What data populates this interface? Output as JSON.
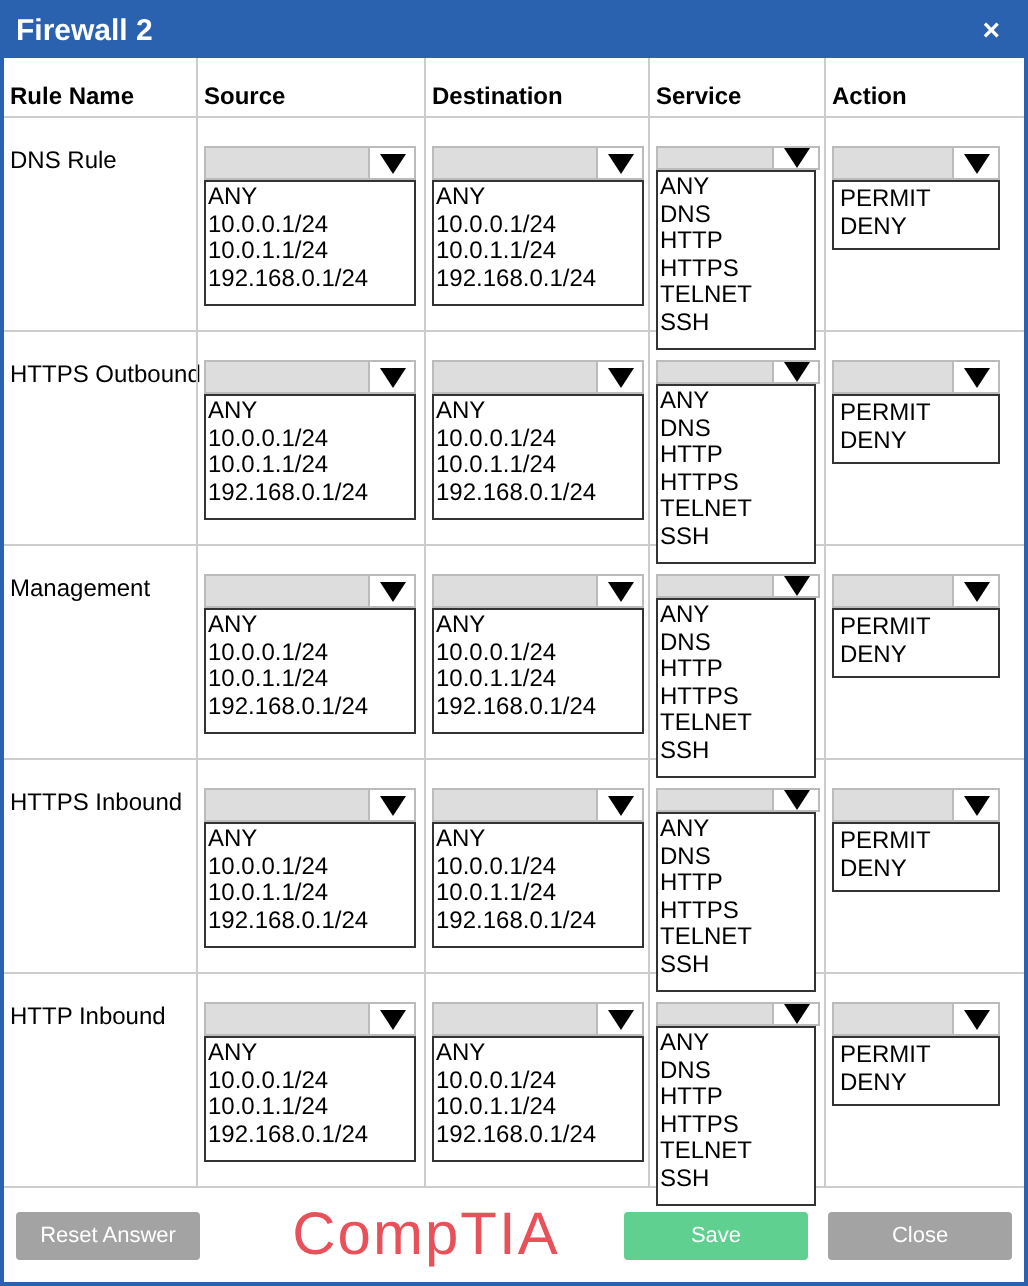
{
  "window": {
    "title": "Firewall 2",
    "close": "×"
  },
  "columns": [
    "Rule Name",
    "Source",
    "Destination",
    "Service",
    "Action"
  ],
  "rules": [
    {
      "name": "DNS Rule",
      "source": [
        "ANY",
        "10.0.0.1/24",
        "10.0.1.1/24",
        "192.168.0.1/24"
      ],
      "destination": [
        "ANY",
        "10.0.0.1/24",
        "10.0.1.1/24",
        "192.168.0.1/24"
      ],
      "service": [
        "ANY",
        "DNS",
        "HTTP",
        "HTTPS",
        "TELNET",
        "SSH"
      ],
      "action": [
        "PERMIT",
        "DENY"
      ]
    },
    {
      "name": "HTTPS Outbound",
      "source": [
        "ANY",
        "10.0.0.1/24",
        "10.0.1.1/24",
        "192.168.0.1/24"
      ],
      "destination": [
        "ANY",
        "10.0.0.1/24",
        "10.0.1.1/24",
        "192.168.0.1/24"
      ],
      "service": [
        "ANY",
        "DNS",
        "HTTP",
        "HTTPS",
        "TELNET",
        "SSH"
      ],
      "action": [
        "PERMIT",
        "DENY"
      ]
    },
    {
      "name": "Management",
      "source": [
        "ANY",
        "10.0.0.1/24",
        "10.0.1.1/24",
        "192.168.0.1/24"
      ],
      "destination": [
        "ANY",
        "10.0.0.1/24",
        "10.0.1.1/24",
        "192.168.0.1/24"
      ],
      "service": [
        "ANY",
        "DNS",
        "HTTP",
        "HTTPS",
        "TELNET",
        "SSH"
      ],
      "action": [
        "PERMIT",
        "DENY"
      ]
    },
    {
      "name": "HTTPS Inbound",
      "source": [
        "ANY",
        "10.0.0.1/24",
        "10.0.1.1/24",
        "192.168.0.1/24"
      ],
      "destination": [
        "ANY",
        "10.0.0.1/24",
        "10.0.1.1/24",
        "192.168.0.1/24"
      ],
      "service": [
        "ANY",
        "DNS",
        "HTTP",
        "HTTPS",
        "TELNET",
        "SSH"
      ],
      "action": [
        "PERMIT",
        "DENY"
      ]
    },
    {
      "name": "HTTP Inbound",
      "source": [
        "ANY",
        "10.0.0.1/24",
        "10.0.1.1/24",
        "192.168.0.1/24"
      ],
      "destination": [
        "ANY",
        "10.0.0.1/24",
        "10.0.1.1/24",
        "192.168.0.1/24"
      ],
      "service": [
        "ANY",
        "DNS",
        "HTTP",
        "HTTPS",
        "TELNET",
        "SSH"
      ],
      "action": [
        "PERMIT",
        "DENY"
      ]
    }
  ],
  "footer": {
    "buttons": [
      {
        "label": "Reset Answer",
        "kind": "secondary"
      },
      {
        "label": "Save",
        "kind": "primary"
      },
      {
        "label": "Close",
        "kind": "secondary"
      }
    ],
    "logo": "CompTIA"
  }
}
